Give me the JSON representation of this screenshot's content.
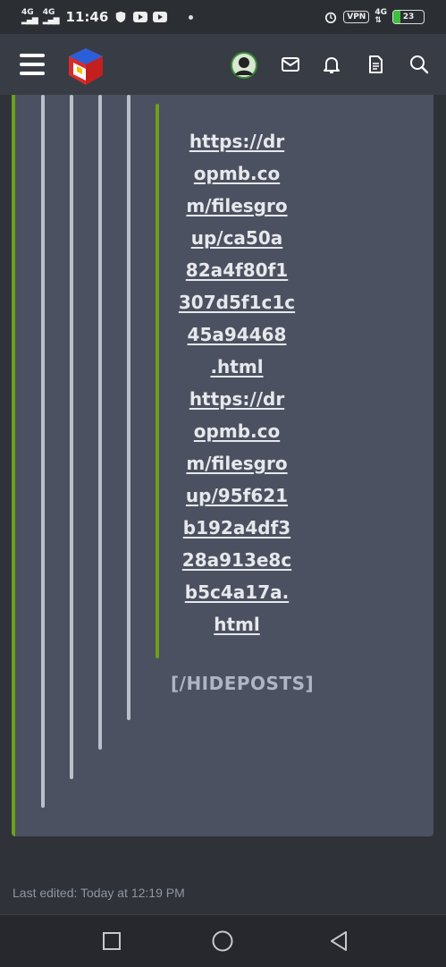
{
  "status_bar": {
    "signal1": "4G",
    "signal2": "4G",
    "time": "11:46",
    "vpn": "VPN",
    "network": "4G",
    "battery": "23"
  },
  "header": {
    "icons": [
      "menu-icon",
      "site-logo",
      "avatar",
      "mail-icon",
      "bell-icon",
      "document-icon",
      "search-icon"
    ]
  },
  "post": {
    "link1_lines": [
      "https://dr",
      "opmb.co",
      "m/filesgro",
      "up/ca50a",
      "82a4f80f1",
      "307d5f1c1c",
      "45a94468",
      ".html"
    ],
    "link2_lines": [
      "https://dr",
      "opmb.co",
      "m/filesgro",
      "up/95f621",
      "b192a4df3",
      "28a913e8c",
      "b5c4a17a.",
      "html"
    ],
    "hide_tag": "[/HIDEPOSTS]",
    "last_edited": "Last edited: Today at 12:19 PM"
  },
  "colors": {
    "accent_green": "#6aa11a",
    "card_bg": "#4b5160",
    "page_bg": "#2f3238"
  }
}
